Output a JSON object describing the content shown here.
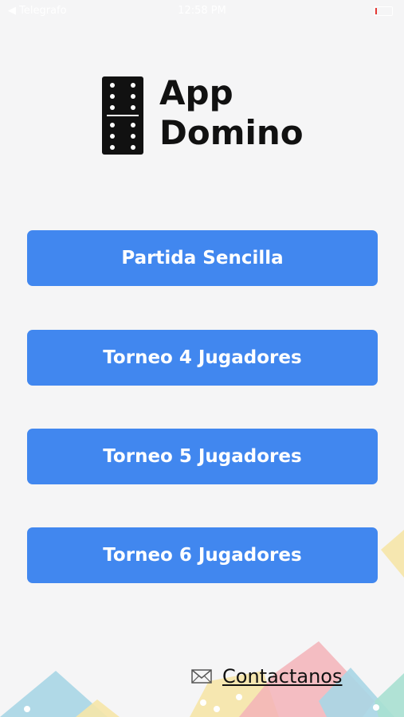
{
  "status_bar": {
    "carrier": "◀ Telegrafo",
    "time": "12:58 PM"
  },
  "logo": {
    "title": "App\nDomino",
    "icon": "domino-tile-icon"
  },
  "menu": {
    "buttons": [
      {
        "label": "Partida Sencilla"
      },
      {
        "label": "Torneo 4 Jugadores"
      },
      {
        "label": "Torneo 5 Jugadores"
      },
      {
        "label": "Torneo 6 Jugadores"
      }
    ]
  },
  "contact": {
    "label": "Contactanos",
    "icon": "mail-icon"
  },
  "colors": {
    "background": "#f5f5f6",
    "button": "#4187ef",
    "button_text": "#ffffff",
    "text": "#111111"
  }
}
